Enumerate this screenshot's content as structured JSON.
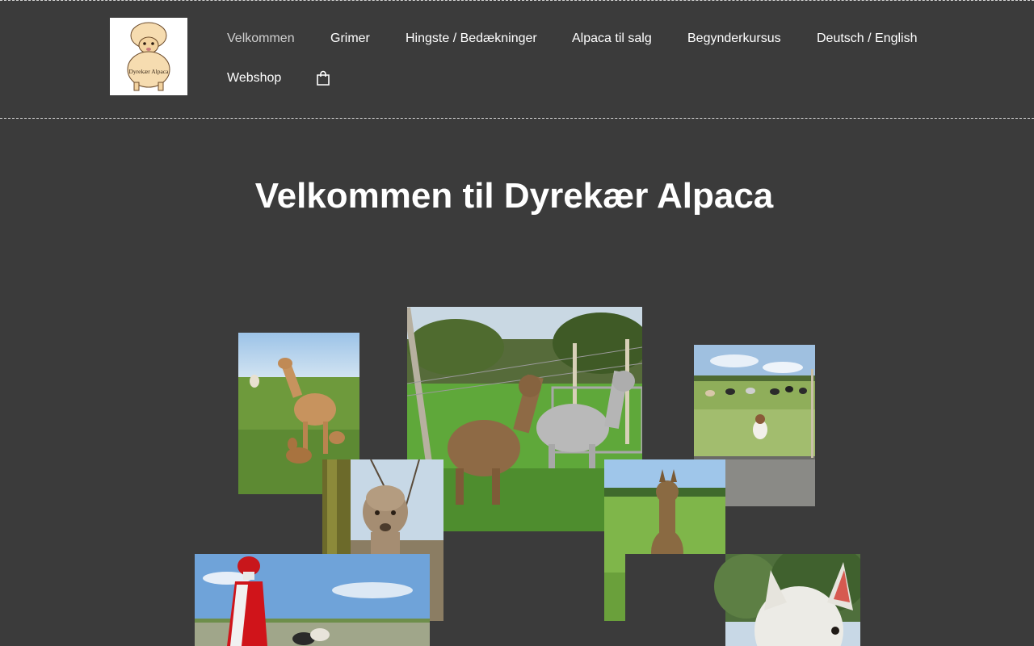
{
  "header": {
    "logo_text": "Dyrekær Alpaca",
    "nav": [
      {
        "label": "Velkommen",
        "active": true
      },
      {
        "label": "Grimer"
      },
      {
        "label": "Hingste / Bedækninger"
      },
      {
        "label": "Alpaca til salg"
      },
      {
        "label": "Begynderkursus"
      },
      {
        "label": "Deutsch / English"
      },
      {
        "label": "Webshop"
      }
    ],
    "cart_icon": "shopping-bag-icon"
  },
  "main": {
    "title": "Velkommen til Dyrekær Alpaca"
  },
  "gallery": {
    "photos": [
      "alpaca-mother-and-cria-photo",
      "two-alpacas-at-fence-photo",
      "dog-watching-alpacas-photo",
      "alpaca-by-tree-photo",
      "brown-cria-in-field-photo",
      "santa-hat-post-photo",
      "white-alpaca-closeup-photo"
    ]
  },
  "colors": {
    "background": "#3b3b3b",
    "text": "#ffffff",
    "active_nav": "#cfcfcf"
  }
}
